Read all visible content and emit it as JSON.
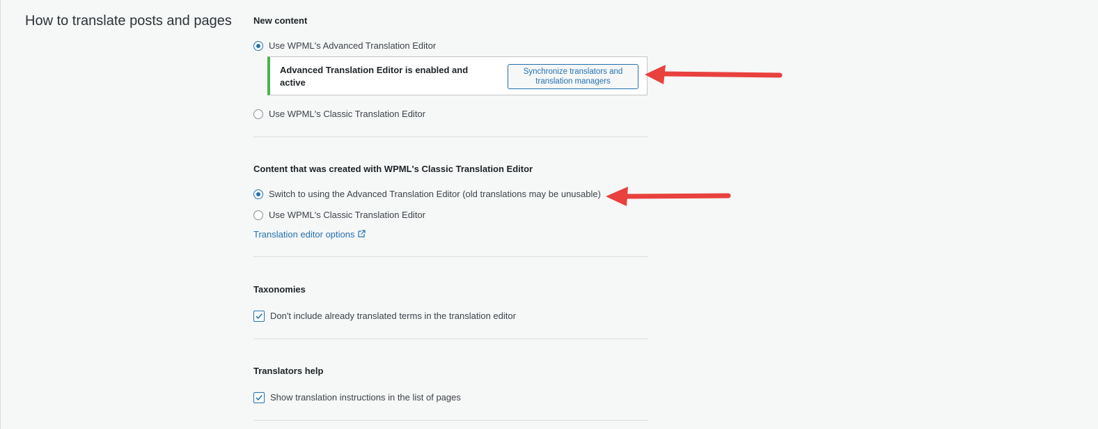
{
  "page": {
    "title": "How to translate posts and pages"
  },
  "new_content": {
    "heading": "New content",
    "option_advanced": {
      "label": "Use WPML's Advanced Translation Editor",
      "selected": true
    },
    "notice": {
      "text": "Advanced Translation Editor is enabled and active",
      "button_label": "Synchronize translators and translation managers"
    },
    "option_classic": {
      "label": "Use WPML's Classic Translation Editor",
      "selected": false
    }
  },
  "classic_content": {
    "heading": "Content that was created with WPML's Classic Translation Editor",
    "option_switch": {
      "label": "Switch to using the Advanced Translation Editor (old translations may be unusable)",
      "selected": true
    },
    "option_classic": {
      "label": "Use WPML's Classic Translation Editor",
      "selected": false
    },
    "link_label": "Translation editor options",
    "link_icon": "external-link-icon"
  },
  "taxonomies": {
    "heading": "Taxonomies",
    "checkbox": {
      "label": "Don't include already translated terms in the translation editor",
      "checked": true
    }
  },
  "translators_help": {
    "heading": "Translators help",
    "checkbox": {
      "label": "Show translation instructions in the list of pages",
      "checked": true
    }
  },
  "colors": {
    "accent": "#2271b1",
    "success_border": "#46b450",
    "annotation_arrow": "#e8413e"
  }
}
